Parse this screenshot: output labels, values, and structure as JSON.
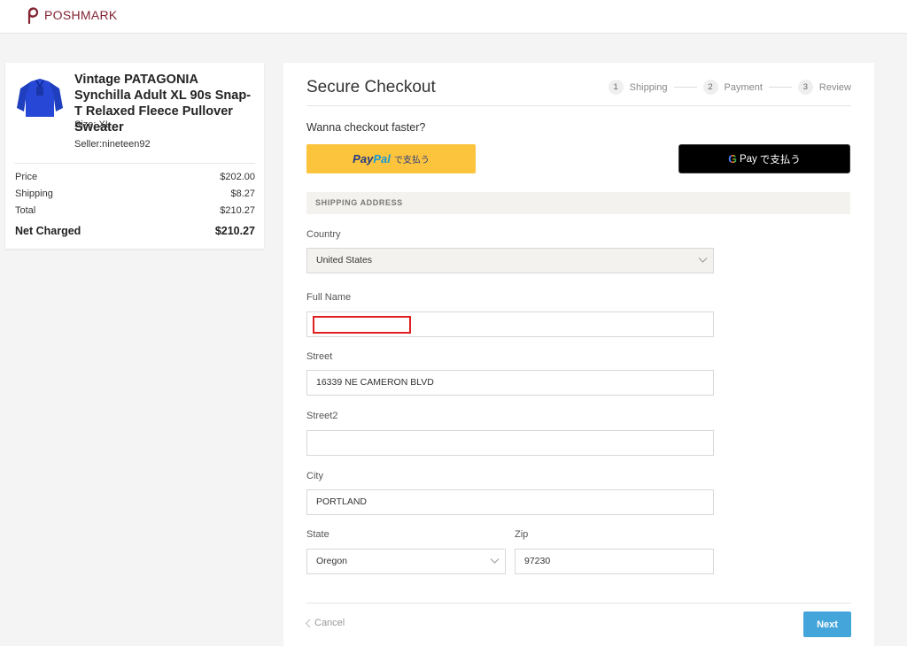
{
  "brand": {
    "name": "POSHMARK",
    "color": "#822432"
  },
  "summary": {
    "title": "Vintage PATAGONIA Synchilla Adult XL 90s Snap-T Relaxed Fleece Pullover Sweater",
    "size": "Size: XL",
    "seller": "Seller:nineteen92",
    "rows": [
      {
        "label": "Price",
        "value": "$202.00"
      },
      {
        "label": "Shipping",
        "value": "$8.27"
      },
      {
        "label": "Total",
        "value": "$210.27"
      }
    ],
    "net": {
      "label": "Net Charged",
      "value": "$210.27"
    }
  },
  "checkout": {
    "title": "Secure Checkout",
    "steps": [
      {
        "num": "1",
        "label": "Shipping"
      },
      {
        "num": "2",
        "label": "Payment"
      },
      {
        "num": "3",
        "label": "Review"
      }
    ],
    "faster": "Wanna checkout faster?",
    "paypal": {
      "pay": "Pay",
      "pal": "Pal",
      "suffix": "で支払う"
    },
    "gpay": {
      "g": "G",
      "pay": "Pay",
      "suffix": "で支払う"
    },
    "section_header": "SHIPPING ADDRESS",
    "fields": {
      "country": {
        "label": "Country",
        "value": "United States"
      },
      "full_name": {
        "label": "Full Name",
        "value": ""
      },
      "street": {
        "label": "Street",
        "value": "16339 NE CAMERON BLVD"
      },
      "street2": {
        "label": "Street2",
        "value": ""
      },
      "city": {
        "label": "City",
        "value": "PORTLAND"
      },
      "state": {
        "label": "State",
        "value": "Oregon"
      },
      "zip": {
        "label": "Zip",
        "value": "97230"
      }
    },
    "cancel": "Cancel",
    "next": "Next"
  }
}
